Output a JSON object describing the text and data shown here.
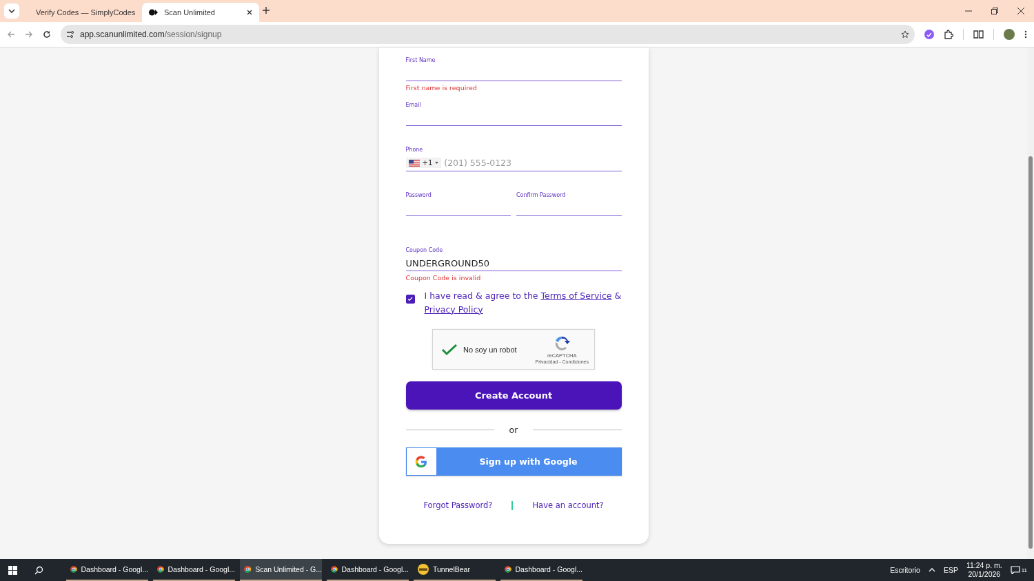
{
  "browser": {
    "tabs": [
      {
        "title": "Verify Codes — SimplyCodes",
        "selected": false
      },
      {
        "title": "Scan Unlimited",
        "selected": true
      }
    ],
    "url": {
      "host": "app.scanunlimited.com",
      "path": "/session/signup"
    }
  },
  "form": {
    "fields": [
      {
        "kind": "text",
        "label": "First Name",
        "error": "First name is required"
      },
      {
        "kind": "text",
        "label": "Email"
      },
      {
        "kind": "phone",
        "label": "Phone",
        "code": "+1",
        "placeholder": "(201) 555-0123"
      },
      {
        "kind": "pair",
        "items": [
          {
            "label": "Password"
          },
          {
            "label": "Confirm Password"
          }
        ]
      },
      {
        "kind": "text",
        "label": "Coupon Code",
        "value": "UNDERGROUND50",
        "error": "Coupon Code is invalid"
      }
    ],
    "agree": {
      "checked": true,
      "text": "I have read & agree to the ",
      "link1": "Terms of Service",
      "joiner": " &",
      "link2": "Privacy Policy"
    },
    "captcha": {
      "checked": true,
      "label": "No soy un robot",
      "brand": "reCAPTCHA",
      "links": "Privacidad - Condiciones"
    },
    "submit": "Create Account",
    "divider": "or",
    "google": "Sign up with Google",
    "links": [
      "Forgot Password?",
      "Have an account?"
    ]
  },
  "taskbar": {
    "apps": [
      {
        "label": "Dashboard - Googl...",
        "selected": false
      },
      {
        "label": "Dashboard - Googl...",
        "selected": false
      },
      {
        "label": "Scan Unlimited - G...",
        "selected": true
      },
      {
        "label": "Dashboard - Googl...",
        "selected": false
      },
      {
        "label": "TunnelBear",
        "selected": false
      },
      {
        "label": "Dashboard - Googl...",
        "selected": false
      }
    ],
    "desktop": "Escritorio",
    "lang": "ESP",
    "time": "11:24 p. m.",
    "date": "20/1/2026",
    "notifications": "11"
  }
}
